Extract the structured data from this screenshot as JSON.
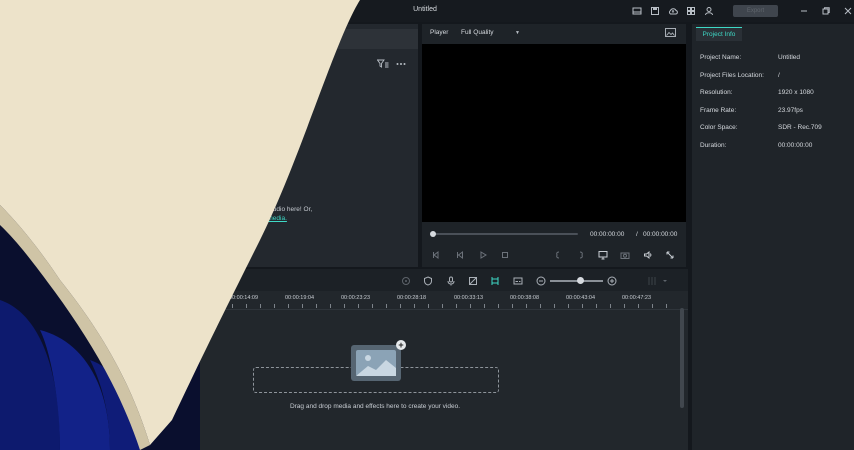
{
  "window": {
    "title": "Untitled",
    "export_label": "Export"
  },
  "media": {
    "import_hint_line1": ", or audio here! Or,",
    "import_hint_link": "ort media."
  },
  "player": {
    "label": "Player",
    "quality": "Full Quality",
    "current_time": "00:00:00:00",
    "separator": "/",
    "total_time": "00:00:00:00"
  },
  "project_info": {
    "tab_label": "Project Info",
    "rows": [
      {
        "label": "Project Name:",
        "value": "Untitled"
      },
      {
        "label": "Project Files Location:",
        "value": "/"
      },
      {
        "label": "Resolution:",
        "value": "1920 x 1080"
      },
      {
        "label": "Frame Rate:",
        "value": "23.97fps"
      },
      {
        "label": "Color Space:",
        "value": "SDR - Rec.709"
      },
      {
        "label": "Duration:",
        "value": "00:00:00:00"
      }
    ]
  },
  "timeline": {
    "ruler_labels": [
      "00:00:14:09",
      "00:00:19:04",
      "00:00:23:23",
      "00:00:28:18",
      "00:00:33:13",
      "00:00:38:08",
      "00:00:43:04",
      "00:00:47:23"
    ],
    "drop_text": "Drag and drop media and effects here to create your video."
  },
  "colors": {
    "accent": "#3ed9c6",
    "panel": "#23282e",
    "canvas": "#000000",
    "page_curl": "#ede3ca"
  }
}
